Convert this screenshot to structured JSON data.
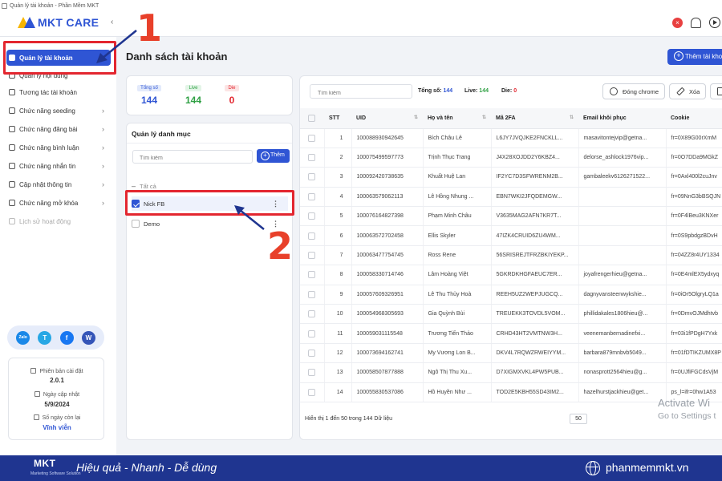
{
  "window": {
    "title": "Quản lý tài khoản - Phần Mềm MKT"
  },
  "brand": {
    "logo_text": "MKT CARE"
  },
  "sidebar": {
    "items": [
      {
        "label": "Quản lý tài khoản",
        "icon": "grid-icon",
        "active": true
      },
      {
        "label": "Quản lý nội dung",
        "icon": "document-icon"
      },
      {
        "label": "Tương tác tài khoản",
        "icon": "swap-icon"
      },
      {
        "label": "Chức năng seeding",
        "icon": "sprout-icon",
        "has_children": true
      },
      {
        "label": "Chức năng đăng bài",
        "icon": "post-icon",
        "has_children": true
      },
      {
        "label": "Chức năng bình luận",
        "icon": "comment-icon",
        "has_children": true
      },
      {
        "label": "Chức năng nhắn tin",
        "icon": "chat-icon",
        "has_children": true
      },
      {
        "label": "Cập nhật thông tin",
        "icon": "text-edit-icon",
        "has_children": true
      },
      {
        "label": "Chức năng mở khóa",
        "icon": "unlock-icon",
        "has_children": true
      },
      {
        "label": "Lịch sử hoạt động",
        "icon": "history-icon",
        "muted": true
      }
    ],
    "social": [
      "Zalo",
      "T",
      "f",
      "W"
    ],
    "version": {
      "installed_label": "Phiên bản cài đặt",
      "installed_value": "2.0.1",
      "updated_label": "Ngày cập nhật",
      "updated_value": "5/9/2024",
      "remaining_label": "Số ngày còn lại",
      "remaining_value": "Vĩnh viễn"
    }
  },
  "header": {
    "page_title": "Danh sách tài khoản",
    "add_account_label": "Thêm tài khoản"
  },
  "stats": {
    "total_label": "Tổng số",
    "total_value": "144",
    "live_label": "Live",
    "live_value": "144",
    "die_label": "Die",
    "die_value": "0"
  },
  "categories": {
    "title": "Quản lý danh mục",
    "search_placeholder": "Tìm kiếm",
    "add_label": "Thêm",
    "all_label": "Tất cả",
    "items": [
      {
        "label": "Nick FB",
        "checked": true
      },
      {
        "label": "Demo",
        "checked": false
      }
    ]
  },
  "table": {
    "search_placeholder": "Tìm kiếm",
    "summary": {
      "total_label": "Tổng số:",
      "total": "144",
      "live_label": "Live:",
      "live": "144",
      "die_label": "Die:",
      "die": "0"
    },
    "buttons": {
      "chrome": "Đóng chrome",
      "delete": "Xóa"
    },
    "columns": [
      "STT",
      "UID",
      "Họ và tên",
      "Mã 2FA",
      "Email khôi phục",
      "Cookie"
    ],
    "rows": [
      [
        "1",
        "100088930942645",
        "Bích Châu Lê",
        "L6JY7JVQJKE2FNCKLL...",
        "masavitontejvip@getna...",
        "fr=0X89G00rXmM"
      ],
      [
        "2",
        "100075499597773",
        "Trịnh Thục Trang",
        "J4X28XOJDD2Y6KBZ4...",
        "delorse_ashlock1976vip...",
        "fr=0O7DDa9MGkZ"
      ],
      [
        "3",
        "100092420738635",
        "Khuất Huệ Lan",
        "IF2YC7D3SFWRENM2B...",
        "gambaleekv6126271522...",
        "fr=0Axl400l2cuJnv"
      ],
      [
        "4",
        "100063579062113",
        "Lê Hồng Nhung ...",
        "EBN7WKI2JFQDEMGW...",
        "",
        "fr=09NnG3bBSQJN"
      ],
      [
        "5",
        "100076164827398",
        "Phạm Minh Châu",
        "V3635MAG2AFN7KR7T...",
        "",
        "fr=0F4lBeu3KNXer"
      ],
      [
        "6",
        "100063572702458",
        "Ellis Skyler",
        "47IZK4CRUID6ZU4WM...",
        "",
        "fr=0S9pbdgzBDvH"
      ],
      [
        "7",
        "100063477754745",
        "Ross Rene",
        "56SRISREJTFRZBKIYEKP...",
        "",
        "fr=04ZZ8r4UY1334"
      ],
      [
        "8",
        "100058330714746",
        "Lâm Hoàng Việt",
        "5GKRDKHGFAEUC7ER...",
        "joyafrengerhieu@getna...",
        "fr=0E4mlEX5ydxyq"
      ],
      [
        "9",
        "100057609326951",
        "Lê Thu Thủy Hoà",
        "REEH5UZ2WEPJUGCQ...",
        "dagnyvansteenwykshie...",
        "fr=0iOr5OlgryLQ1a"
      ],
      [
        "10",
        "100054968305693",
        "Gia Quỳnh Bùi",
        "TREUEKK3TOVDL5VOM...",
        "phillidakales1806hieu@...",
        "fr=0DmvOJMdhtvb"
      ],
      [
        "11",
        "100059031115548",
        "Trương Tiến Thảo",
        "CRHD43HT2VMTNW3H...",
        "veenemanbernadinefxi...",
        "fr=03i1fPDgH7Yxk"
      ],
      [
        "12",
        "100073694162741",
        "My Vương Lon B...",
        "DKV4L7RQWZRWEIYYM...",
        "barbara879mnbvb5049...",
        "fr=01fDTIKZUMX8P"
      ],
      [
        "13",
        "100058507877888",
        "Ngô Thị Thu Xu...",
        "D7XIGMXVKL4PW5PUB...",
        "nonasprott2564hieu@g...",
        "fr=0UJfiFGCdsVjM"
      ],
      [
        "14",
        "100055830537086",
        "Hồ Huyền Như ...",
        "TOD2E5KBH55SD43IM2...",
        "hazelhurstjackhieu@get...",
        "ps_l=ifr=0hw1A53"
      ]
    ],
    "footer_text": "Hiển thị 1 đến 50 trong 144 Dữ liệu",
    "page_size": "50"
  },
  "annotations": {
    "step1": "1",
    "step2": "2"
  },
  "watermark": {
    "line1": "Activate Wi",
    "line2": "Go to Settings t"
  },
  "footer": {
    "logo": "MKT",
    "logo_sub": "Marketing Software Solution",
    "tagline": "Hiệu quả - Nhanh - Dễ dùng",
    "website": "phanmemmkt.vn"
  },
  "colors": {
    "primary": "#2f55d4",
    "live": "#2ea043",
    "die": "#e3262f",
    "annotation": "#e8402a",
    "footer_bg": "#1f3590"
  }
}
